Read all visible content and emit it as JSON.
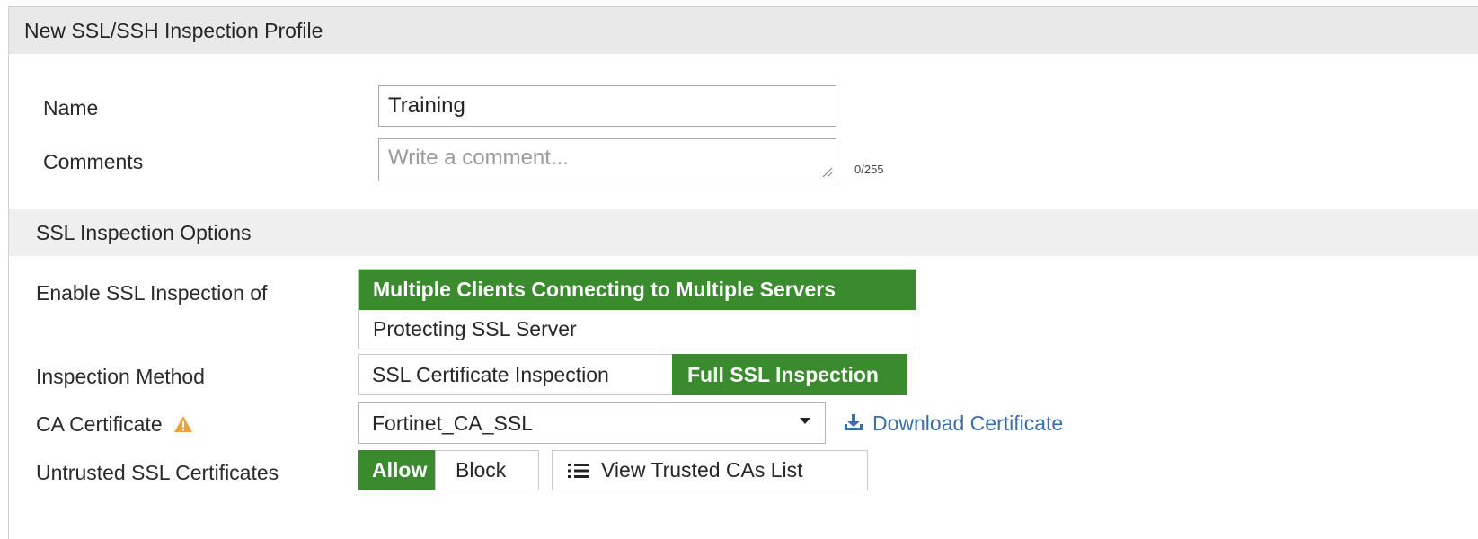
{
  "title": "New SSL/SSH Inspection Profile",
  "form": {
    "name_label": "Name",
    "name_value": "Training",
    "comments_label": "Comments",
    "comments_placeholder": "Write a comment...",
    "comments_counter": "0/255"
  },
  "ssl_section": {
    "title": "SSL Inspection Options",
    "enable_label": "Enable SSL Inspection of",
    "enable_options": [
      {
        "label": "Multiple Clients Connecting to Multiple Servers",
        "selected": true
      },
      {
        "label": "Protecting SSL Server",
        "selected": false
      }
    ],
    "method_label": "Inspection Method",
    "method_options": [
      {
        "label": "SSL Certificate Inspection",
        "selected": false
      },
      {
        "label": "Full SSL Inspection",
        "selected": true
      }
    ],
    "ca_label": "CA Certificate",
    "ca_warning_icon": "warning-triangle-icon",
    "ca_value": "Fortinet_CA_SSL",
    "download_label": "Download Certificate",
    "untrusted_label": "Untrusted SSL Certificates",
    "untrusted_options": [
      {
        "label": "Allow",
        "selected": true
      },
      {
        "label": "Block",
        "selected": false
      }
    ],
    "view_cas_label": "View Trusted CAs List"
  },
  "colors": {
    "selected_green": "#3a8a2e",
    "link_blue": "#3b6ea8",
    "warning_orange": "#e8a33c"
  }
}
